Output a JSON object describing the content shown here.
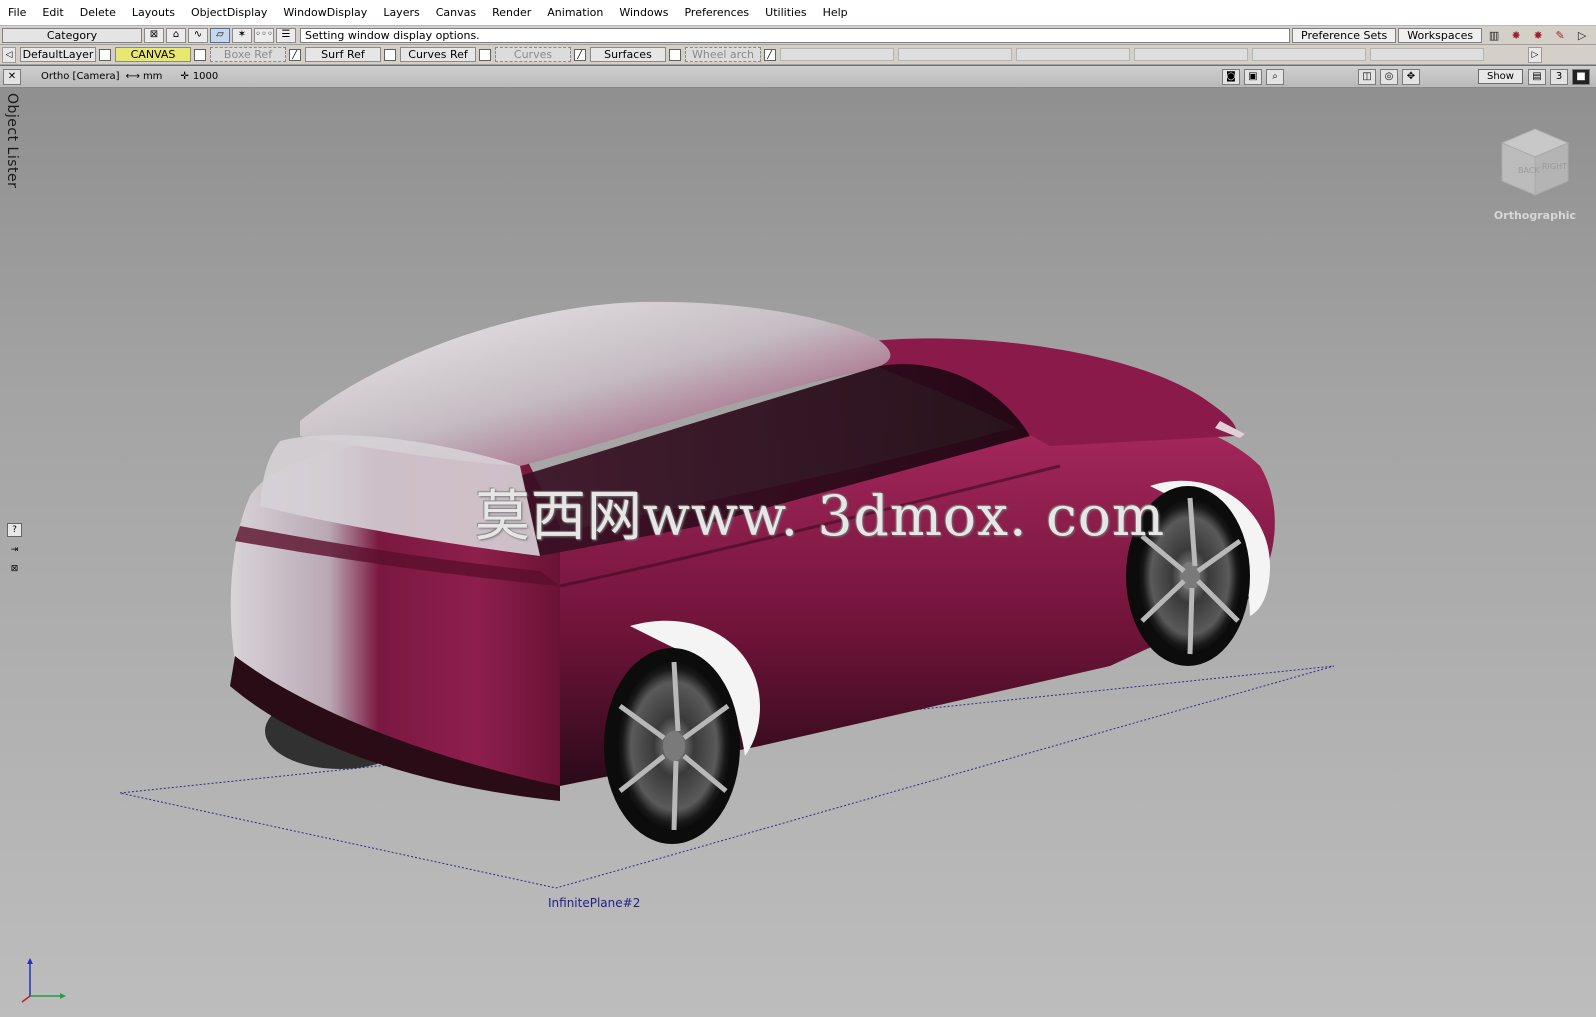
{
  "menubar": {
    "items": [
      "File",
      "Edit",
      "Delete",
      "Layouts",
      "ObjectDisplay",
      "WindowDisplay",
      "Layers",
      "Canvas",
      "Render",
      "Animation",
      "Windows",
      "Preferences",
      "Utilities",
      "Help"
    ]
  },
  "shelf": {
    "category_label": "Category",
    "prompt_message": "Setting window display options.",
    "preference_sets_label": "Preference Sets",
    "workspaces_label": "Workspaces"
  },
  "layers": [
    {
      "name": "DefaultLayer",
      "state": "normal"
    },
    {
      "name": "CANVAS",
      "state": "active"
    },
    {
      "name": "Boxe Ref",
      "state": "hidden"
    },
    {
      "name": "Surf Ref",
      "state": "normal"
    },
    {
      "name": "Curves Ref",
      "state": "normal"
    },
    {
      "name": "Curves",
      "state": "hidden"
    },
    {
      "name": "Surfaces",
      "state": "normal"
    },
    {
      "name": "Wheel arch",
      "state": "hidden"
    }
  ],
  "viewport": {
    "camera_label": "Ortho [Camera]",
    "unit_label": "mm",
    "grid_label": "1000",
    "show_label": "Show",
    "quality_label": "3",
    "lister_label": "Object Lister",
    "viewcube_label": "Orthographic",
    "viewcube_faces": [
      "BACK",
      "RIGHT"
    ],
    "plane_label": "InfinitePlane#2",
    "watermark": "莫西网www. 3dmox. com"
  },
  "colors": {
    "car_body": "#7a1840",
    "active_layer": "#e8e870",
    "plane_outline": "#2c2c8a"
  }
}
